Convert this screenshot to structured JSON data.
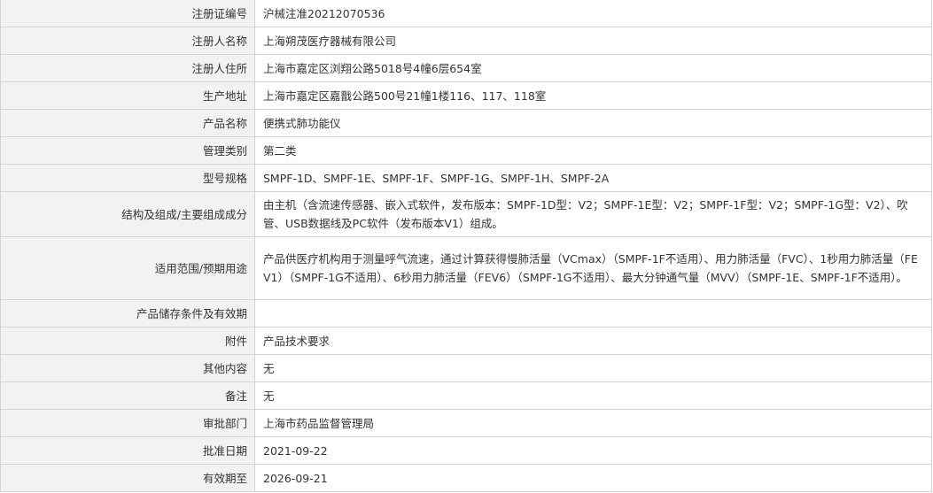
{
  "rows": [
    {
      "label": "注册证编号",
      "value": "沪械注准20212070536"
    },
    {
      "label": "注册人名称",
      "value": "上海朔茂医疗器械有限公司"
    },
    {
      "label": "注册人住所",
      "value": "上海市嘉定区浏翔公路5018号4幢6层654室"
    },
    {
      "label": "生产地址",
      "value": "上海市嘉定区嘉戬公路500号21幢1楼116、117、118室"
    },
    {
      "label": "产品名称",
      "value": "便携式肺功能仪"
    },
    {
      "label": "管理类别",
      "value": "第二类"
    },
    {
      "label": "型号规格",
      "value": "SMPF-1D、SMPF-1E、SMPF-1F、SMPF-1G、SMPF-1H、SMPF-2A"
    },
    {
      "label": "结构及组成/主要组成成分",
      "value": "由主机（含流速传感器、嵌入式软件，发布版本：SMPF-1D型：V2；SMPF-1E型：V2；SMPF-1F型：V2；SMPF-1G型：V2）、吹管、USB数据线及PC软件（发布版本V1）组成。"
    },
    {
      "label": "适用范围/预期用途",
      "value": "产品供医疗机构用于测量呼气流速，通过计算获得慢肺活量（VCmax）（SMPF-1F不适用）、用力肺活量（FVC）、1秒用力肺活量（FEV1）（SMPF-1G不适用）、6秒用力肺活量（FEV6）（SMPF-1G不适用）、最大分钟通气量（MVV）（SMPF-1E、SMPF-1F不适用）。"
    },
    {
      "label": "产品储存条件及有效期",
      "value": ""
    },
    {
      "label": "附件",
      "value": "产品技术要求"
    },
    {
      "label": "其他内容",
      "value": "无"
    },
    {
      "label": "备注",
      "value": "无"
    },
    {
      "label": "审批部门",
      "value": "上海市药品监督管理局"
    },
    {
      "label": "批准日期",
      "value": "2021-09-22"
    },
    {
      "label": "有效期至",
      "value": "2026-09-21"
    }
  ]
}
